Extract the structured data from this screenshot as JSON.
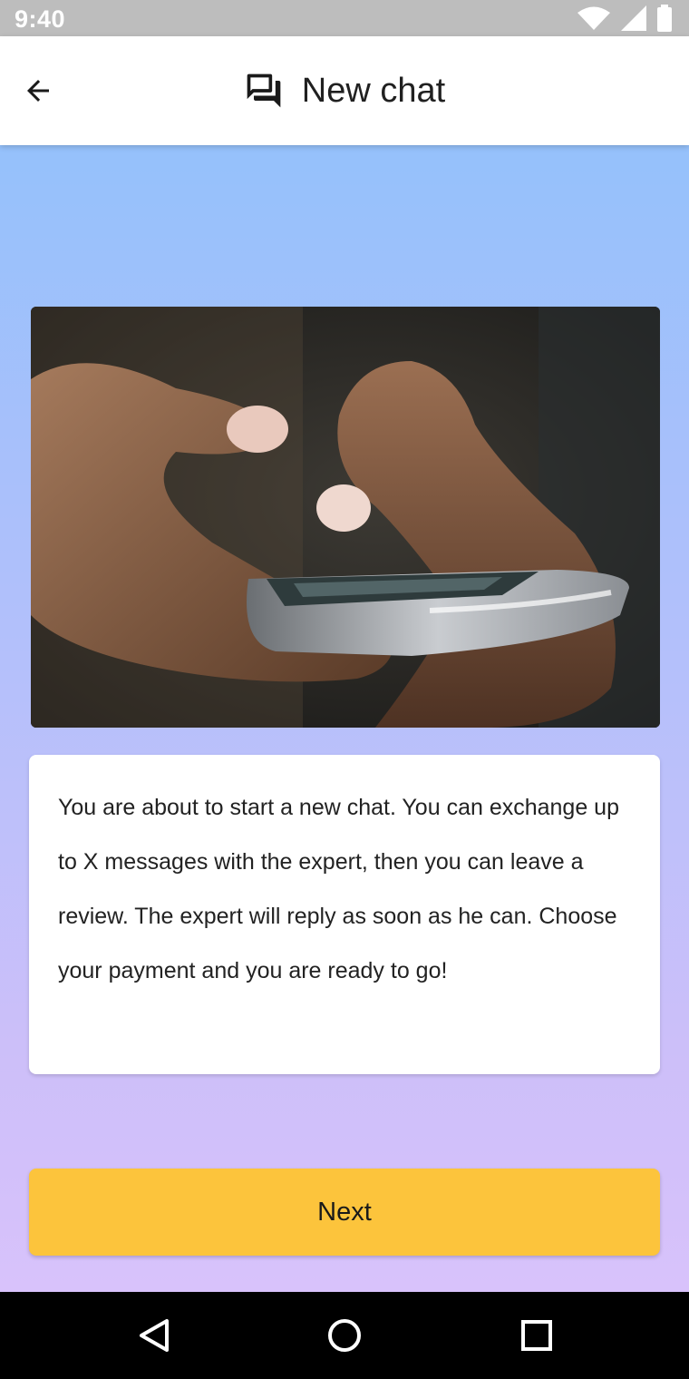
{
  "status_bar": {
    "time": "9:40",
    "icons": [
      "wifi-icon",
      "signal-icon",
      "battery-icon"
    ]
  },
  "app_bar": {
    "back_icon": "arrow-back-icon",
    "title_icon": "chat-bubbles-icon",
    "title": "New chat"
  },
  "hero": {
    "image": "photo of hands typing on a smartphone"
  },
  "info": {
    "text": "You are about to start a new chat. You can exchange up to X messages with the expert, then you can leave a review. The expert will reply as soon as he can. Choose your payment and you are ready to go!"
  },
  "actions": {
    "next_label": "Next"
  },
  "nav_bar": {
    "icons": [
      "back-triangle-icon",
      "home-circle-icon",
      "recents-square-icon"
    ]
  },
  "colors": {
    "status_bar": "#bdbdbd",
    "gradient_top": "#95c1fb",
    "gradient_bottom": "#d8c2fb",
    "accent_button": "#fcc43c",
    "nav_bar": "#000000"
  }
}
